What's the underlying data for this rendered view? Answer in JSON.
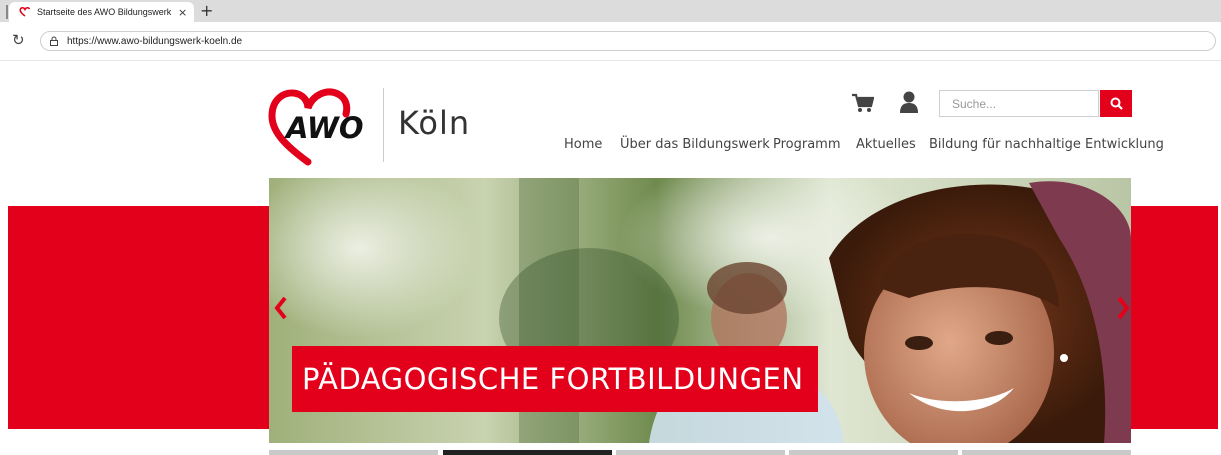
{
  "browser": {
    "tab_title": "Startseite des AWO Bildungswerk",
    "tab_close": "×",
    "new_tab": "+",
    "url": "https://www.awo-bildungswerk-koeln.de"
  },
  "header": {
    "logo_text": "AWO",
    "city": "Köln",
    "search_placeholder": "Suche...",
    "nav": [
      "Home",
      "Über das Bildungswerk",
      "Programm",
      "Aktuelles",
      "Bildung für nachhaltige Entwicklung"
    ]
  },
  "hero": {
    "caption": "PÄDAGOGISCHE FORTBILDUNGEN",
    "active_slide": 2,
    "slide_count": 5
  },
  "colors": {
    "brand_red": "#e2001a"
  }
}
